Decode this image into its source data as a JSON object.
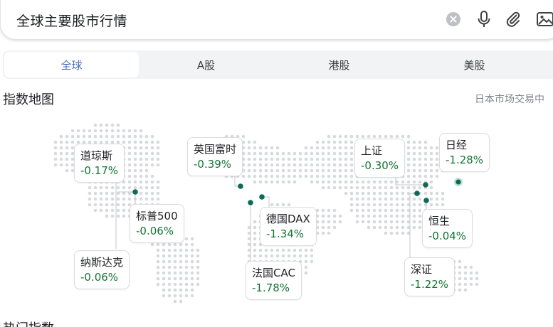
{
  "search": {
    "query": "全球主要股市行情"
  },
  "icons": {
    "clear": "clear-icon",
    "mic": "mic-icon",
    "attach": "paperclip-icon",
    "image": "image-search-icon"
  },
  "tabs": [
    {
      "label": "全球",
      "active": true
    },
    {
      "label": "A股",
      "active": false
    },
    {
      "label": "港股",
      "active": false
    },
    {
      "label": "美股",
      "active": false
    }
  ],
  "section": {
    "title": "指数地图",
    "status": "日本市场交易中"
  },
  "indices": {
    "dow": {
      "name": "道琼斯",
      "change": "-0.17%"
    },
    "sp500": {
      "name": "标普500",
      "change": "-0.06%"
    },
    "nasdaq": {
      "name": "纳斯达克",
      "change": "-0.06%"
    },
    "ftse": {
      "name": "英国富时",
      "change": "-0.39%"
    },
    "dax": {
      "name": "德国DAX",
      "change": "-1.34%"
    },
    "cac": {
      "name": "法国CAC",
      "change": "-1.78%"
    },
    "shanghai": {
      "name": "上证",
      "change": "-0.30%"
    },
    "nikkei": {
      "name": "日经",
      "change": "-1.28%"
    },
    "hangseng": {
      "name": "恒生",
      "change": "-0.04%"
    },
    "shenzhen": {
      "name": "深证",
      "change": "-1.22%"
    }
  },
  "colors": {
    "accent": "#4f6fbf",
    "change": "#137333",
    "marker": "#0b6b57"
  },
  "footer": {
    "heading": "热门指数"
  }
}
